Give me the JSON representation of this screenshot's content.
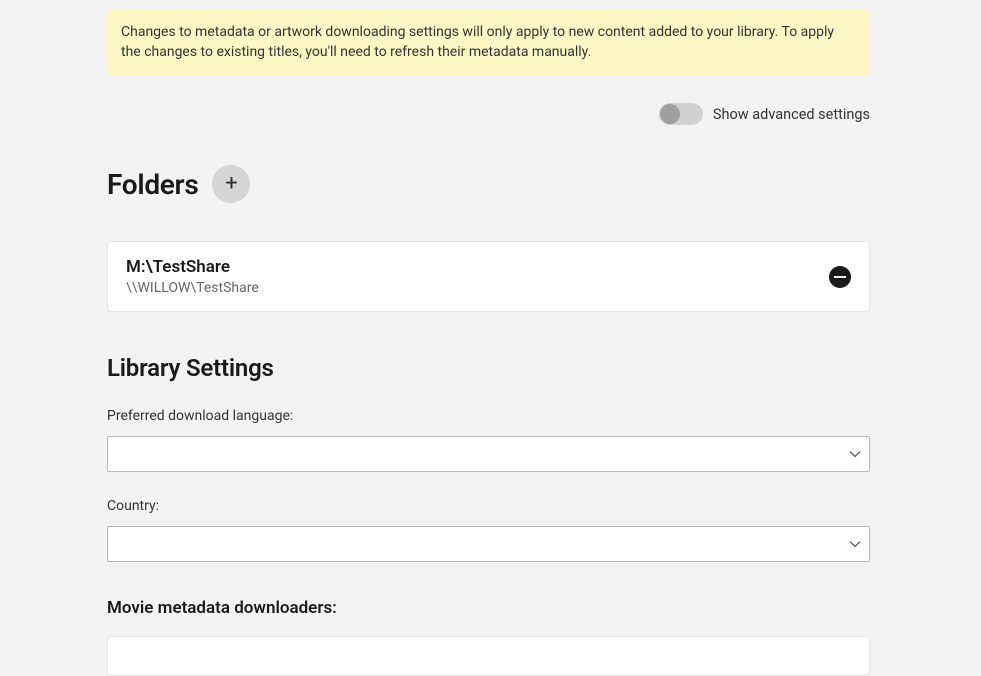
{
  "notice": {
    "text": "Changes to metadata or artwork downloading settings will only apply to new content added to your library. To apply the changes to existing titles, you'll need to refresh their metadata manually."
  },
  "advanced_toggle": {
    "label": "Show advanced settings",
    "on": false
  },
  "folders": {
    "title": "Folders",
    "items": [
      {
        "primary": "M:\\TestShare",
        "secondary": "\\\\WILLOW\\TestShare"
      }
    ]
  },
  "library_settings": {
    "title": "Library Settings",
    "language_label": "Preferred download language:",
    "language_value": "",
    "country_label": "Country:",
    "country_value": ""
  },
  "downloaders": {
    "title": "Movie metadata downloaders:"
  }
}
